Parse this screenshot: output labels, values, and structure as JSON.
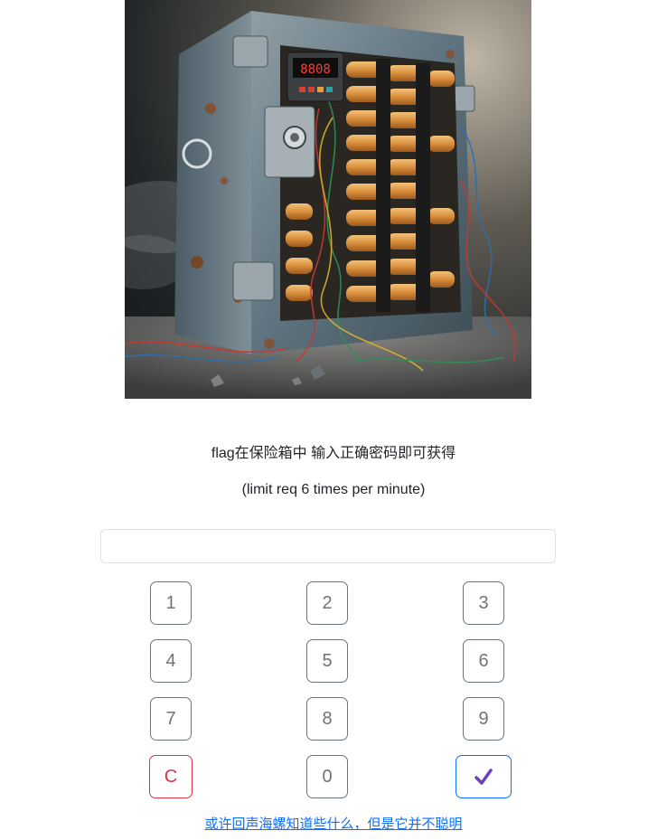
{
  "hero": {
    "display_readout": "8808"
  },
  "intro": {
    "line1": "flag在保险箱中 输入正确密码即可获得",
    "line2": "(limit req 6 times per minute)"
  },
  "code_input": {
    "value": "",
    "placeholder": ""
  },
  "keypad": {
    "keys": [
      "1",
      "2",
      "3",
      "4",
      "5",
      "6",
      "7",
      "8",
      "9",
      "C",
      "0"
    ],
    "submit_icon": "checkmark-icon",
    "colors": {
      "digit": "#6c757d",
      "clear": "#dc3545",
      "submit_border": "#0d6efd",
      "submit_icon": "#6f42c1"
    }
  },
  "hint": {
    "link_text": "或许回声海螺知道些什么，但是它并不聪明"
  }
}
